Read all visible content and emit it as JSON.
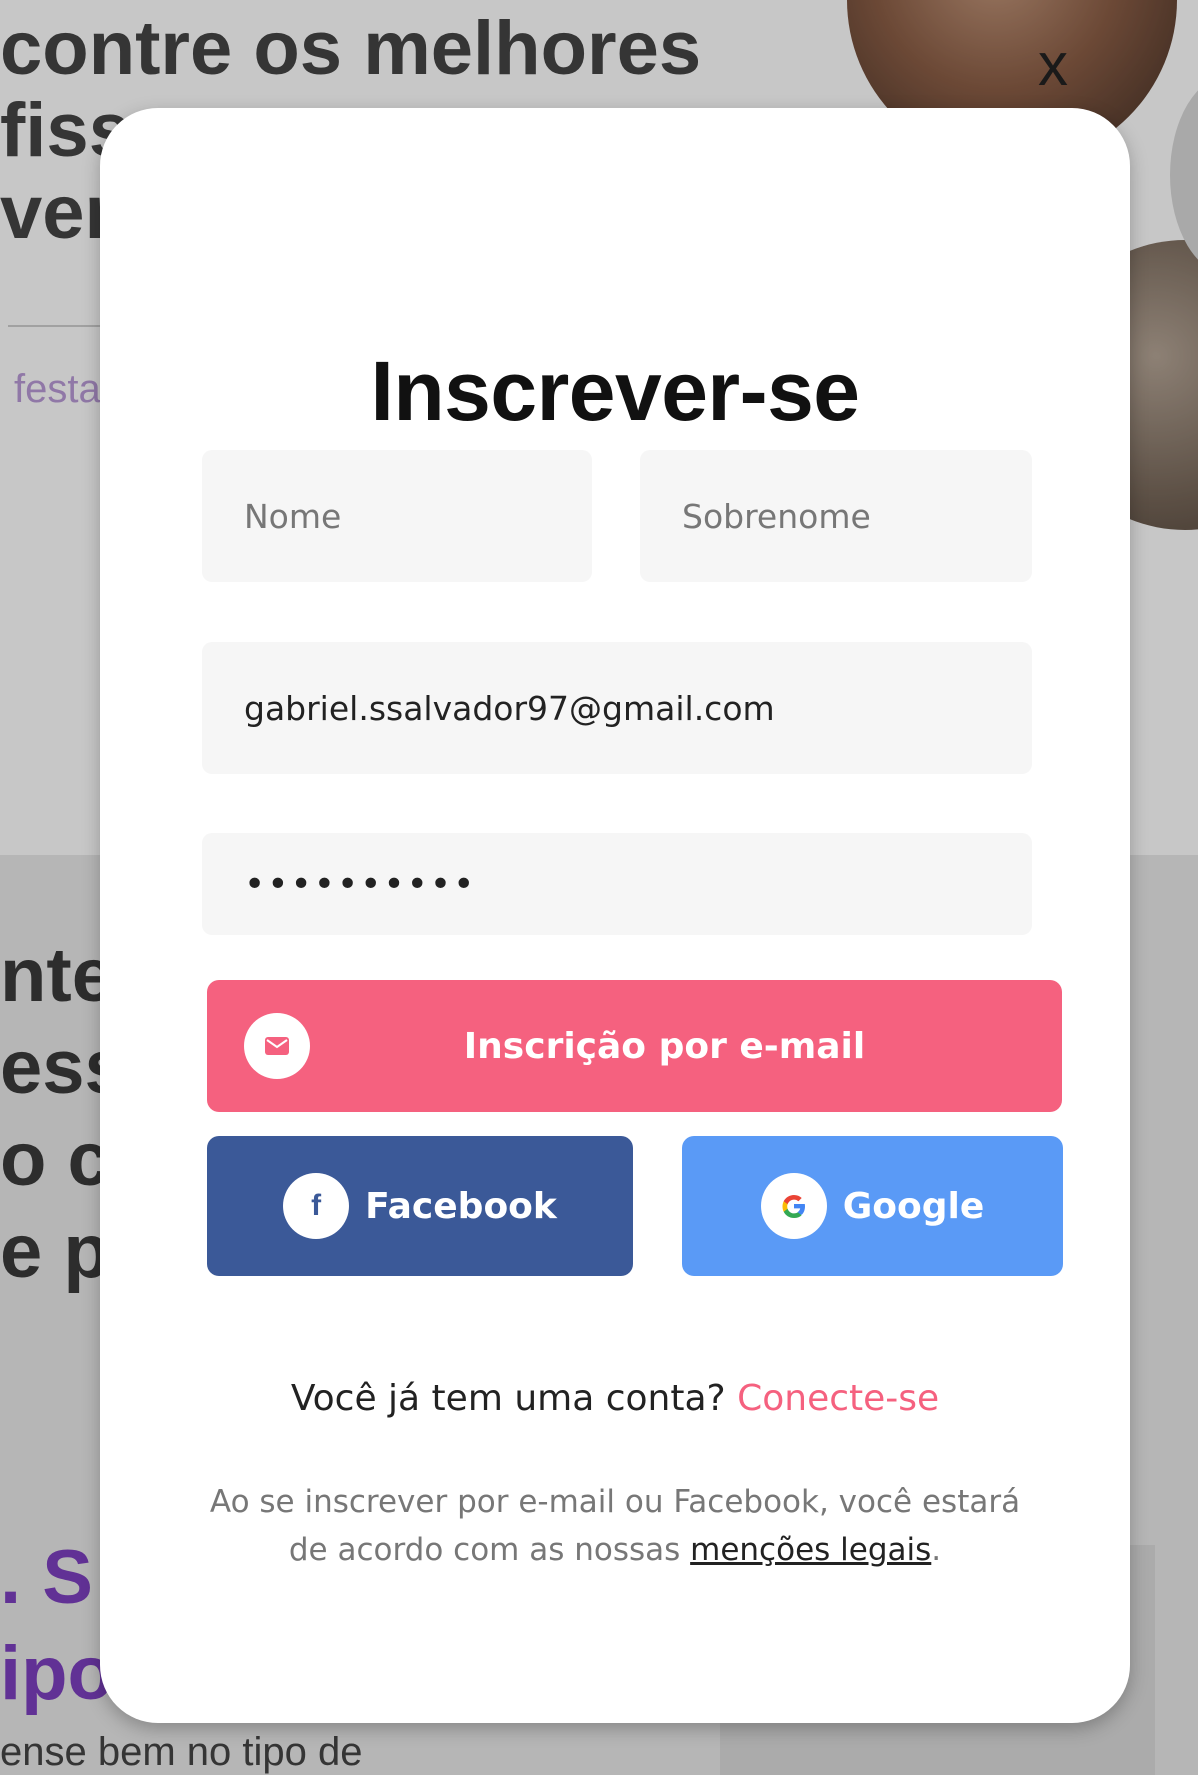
{
  "background": {
    "hero_lines": [
      "contre os melhores",
      "fiss",
      "ver"
    ],
    "search_placeholder": "festa",
    "close_label": "x",
    "section_lines": [
      "nte",
      "ess",
      "o c",
      "e pr"
    ],
    "purple_lines": [
      ". S",
      "ipo"
    ],
    "bottom_text": "ense bem no tipo de"
  },
  "modal": {
    "title": "Inscrever-se",
    "first_name": {
      "placeholder": "Nome",
      "value": ""
    },
    "last_name": {
      "placeholder": "Sobrenome",
      "value": ""
    },
    "email": {
      "value": "gabriel.ssalvador97@gmail.com"
    },
    "password": {
      "masked_value": "••••••••••"
    },
    "email_signup_button": {
      "label": "Inscrição por e-mail",
      "icon": "envelope-icon"
    },
    "facebook_button": {
      "label": "Facebook",
      "icon": "facebook-icon",
      "icon_glyph": "f"
    },
    "google_button": {
      "label": "Google",
      "icon": "google-icon",
      "icon_glyph": "G"
    },
    "have_account": {
      "text": "Você já tem uma conta?",
      "link": "Conecte-se"
    },
    "legal": {
      "text_before": "Ao se inscrever por e-mail ou Facebook, você estará de acordo com as nossas",
      "link": "menções legais",
      "text_after": "."
    }
  },
  "colors": {
    "accent_pink": "#f5617f",
    "facebook_blue": "#3b5998",
    "google_blue": "#5a9af6",
    "field_bg": "#f6f6f6"
  }
}
